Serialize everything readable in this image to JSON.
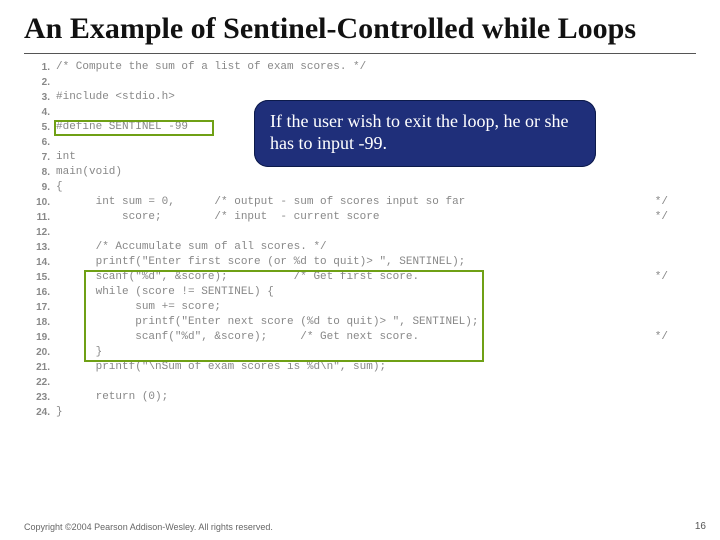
{
  "title": "An Example of Sentinel-Controlled while Loops",
  "callout": "If the user wish to exit the loop, he or she has to input -99.",
  "code": {
    "lines": [
      "/* Compute the sum of a list of exam scores. */",
      "",
      "#include <stdio.h>",
      "",
      "#define SENTINEL -99",
      "",
      "int",
      "main(void)",
      "{",
      "      int sum = 0,      /* output - sum of scores input so far",
      "          score;        /* input  - current score",
      "",
      "      /* Accumulate sum of all scores. */",
      "      printf(\"Enter first score (or %d to quit)> \", SENTINEL);",
      "      scanf(\"%d\", &score);          /* Get first score.",
      "      while (score != SENTINEL) {",
      "            sum += score;",
      "            printf(\"Enter next score (%d to quit)> \", SENTINEL);",
      "            scanf(\"%d\", &score);     /* Get next score.",
      "      }",
      "      printf(\"\\nSum of exam scores is %d\\n\", sum);",
      "",
      "      return (0);",
      "}"
    ],
    "right_markers": {
      "10": "*/",
      "11": "*/",
      "15": "*/",
      "19": "*/"
    }
  },
  "footer": "Copyright ©2004 Pearson Addison-Wesley. All rights reserved.",
  "page_number": "16"
}
